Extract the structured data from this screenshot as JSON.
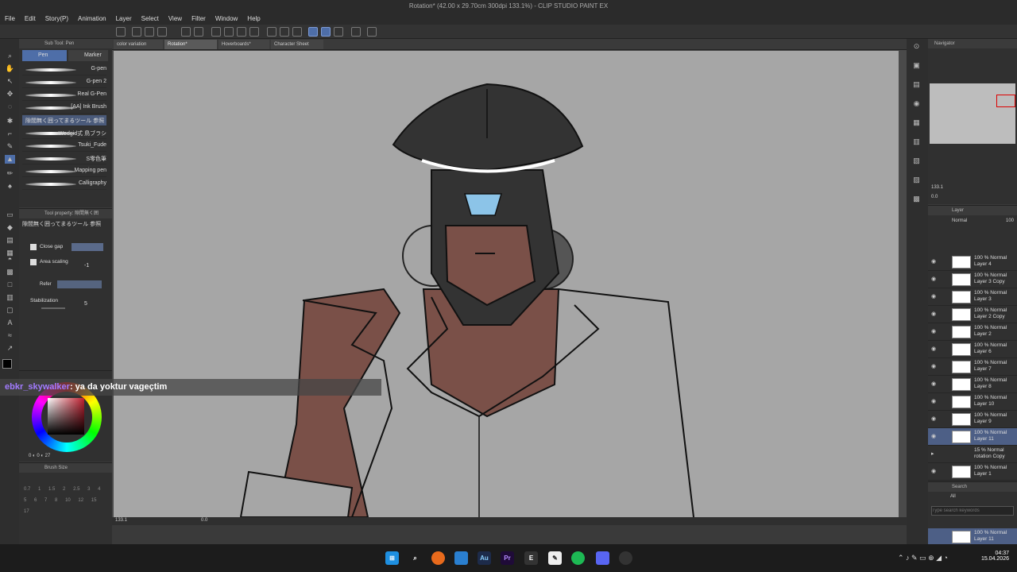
{
  "window": {
    "title": "Rotation* (42.00 x 29.70cm 300dpi 133.1%) - CLIP STUDIO PAINT EX"
  },
  "menu": [
    "File",
    "Edit",
    "Story(P)",
    "Animation",
    "Layer",
    "Select",
    "View",
    "Filter",
    "Window",
    "Help"
  ],
  "sub_tool": {
    "header": "Sub Tool: Pen",
    "tabs": [
      "Pen",
      "Marker"
    ],
    "brushes": [
      "G-pen",
      "G-pen 2",
      "Real G-Pen",
      "[AA] Ink Brush",
      "隙間無く囲ってまるツール 参照",
      "Wedgid式 鳥ブラシ",
      "Tsuki_Fude",
      "S零色筆",
      "Mapping pen",
      "Calligraphy"
    ]
  },
  "tool_property": {
    "header": "Tool property: 隙間無く囲",
    "name": "隙間無く囲ってまるツール 参照",
    "close_gap": "Close gap",
    "area_scaling": "Area scaling",
    "area_scaling_value": "-1",
    "refer": "Refer",
    "stabilization": "Stabilization",
    "stabilization_value": "5"
  },
  "color": {
    "values": [
      "0",
      "0",
      "27"
    ],
    "main": "#000000",
    "hue_marker": "#d04050"
  },
  "brush_size": {
    "header": "Brush Size",
    "sizes": [
      "0.7",
      "1",
      "1.5",
      "2",
      "2.5",
      "3",
      "4",
      "5",
      "6",
      "7",
      "8",
      "10",
      "12",
      "15",
      "17"
    ]
  },
  "doc_tabs": [
    "color variation",
    "Rotation*",
    "Hoverboards*",
    "Character Sheet"
  ],
  "status": {
    "zoom": "133.1",
    "rotation": "0.0"
  },
  "navigator": {
    "header": "Navigator",
    "zoom": "133.1",
    "angle": "0.0"
  },
  "layer_panel": {
    "header": "Layer",
    "blend": "Normal",
    "opacity": "100",
    "layers": [
      {
        "opacity": "100 % Normal",
        "name": "Layer 4",
        "selected": false
      },
      {
        "opacity": "100 % Normal",
        "name": "Layer 3 Copy",
        "selected": false
      },
      {
        "opacity": "100 % Normal",
        "name": "Layer 3",
        "selected": false
      },
      {
        "opacity": "100 % Normal",
        "name": "Layer 2 Copy",
        "selected": false
      },
      {
        "opacity": "100 % Normal",
        "name": "Layer 2",
        "selected": false
      },
      {
        "opacity": "100 % Normal",
        "name": "Layer 6",
        "selected": false
      },
      {
        "opacity": "100 % Normal",
        "name": "Layer 7",
        "selected": false
      },
      {
        "opacity": "100 % Normal",
        "name": "Layer 8",
        "selected": false
      },
      {
        "opacity": "100 % Normal",
        "name": "Layer 10",
        "selected": false
      },
      {
        "opacity": "100 % Normal",
        "name": "Layer 9",
        "selected": false
      },
      {
        "opacity": "100 % Normal",
        "name": "Layer 11",
        "selected": true
      },
      {
        "opacity": "15 % Normal",
        "name": "rotation Copy",
        "selected": false
      },
      {
        "opacity": "100 % Normal",
        "name": "Layer 1",
        "selected": false
      }
    ]
  },
  "search_panel": {
    "header": "Search",
    "dropdown": "All",
    "placeholder": "Type search keywords",
    "layer_opacity": "100 % Normal",
    "layer_name": "Layer 11"
  },
  "chat": {
    "user": "ebkr_skywalker",
    "message": ": ya da yoktur vageçtim"
  },
  "taskbar": {
    "time": "04:37",
    "date": "15.04.2026",
    "apps": [
      "windows-icon",
      "search-icon",
      "firefox-icon",
      "edge-icon",
      "audition-icon",
      "premiere-icon",
      "epic-icon",
      "clip-studio-icon",
      "spotify-icon",
      "discord-icon",
      "obs-icon"
    ]
  },
  "colors": {
    "accent": "#4e6ea8",
    "canvas_bg": "#a6a6a6",
    "skin": "#7a5048",
    "visor": "#8cc4e8",
    "helmet": "#333333"
  }
}
